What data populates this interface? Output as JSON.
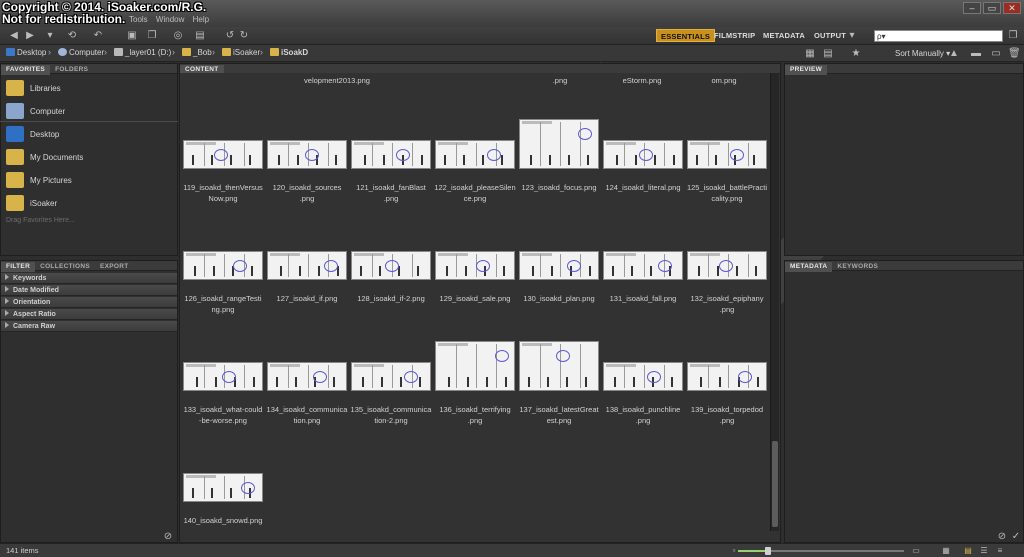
{
  "watermark": {
    "line1": "Copyright © 2014. iSoaker.com/R.G.",
    "line2": "Not for redistribution."
  },
  "menu": {
    "items": [
      "Tools",
      "Window",
      "Help"
    ]
  },
  "workspaces": {
    "essentials": "ESSENTIALS",
    "filmstrip": "FILMSTRIP",
    "metadata": "METADATA",
    "output": "OUTPUT"
  },
  "search": {
    "placeholder": "ρ▾"
  },
  "sort": {
    "label": "Sort Manually"
  },
  "breadcrumb": [
    {
      "label": "Desktop"
    },
    {
      "label": "Computer"
    },
    {
      "label": "_layer01 (D:)"
    },
    {
      "label": "_Bob"
    },
    {
      "label": "iSoaker"
    },
    {
      "label": "iSoakD"
    }
  ],
  "panels": {
    "left_top_tabs": [
      "FAVORITES",
      "FOLDERS"
    ],
    "left_bottom_tabs": [
      "FILTER",
      "COLLECTIONS",
      "EXPORT"
    ],
    "content_tab": "CONTENT",
    "preview_tab": "PREVIEW",
    "right_bottom_tabs": [
      "METADATA",
      "KEYWORDS"
    ]
  },
  "favorites": [
    {
      "label": "Libraries",
      "icon": "libraries-icon",
      "color": "#d8b34a"
    },
    {
      "label": "Computer",
      "icon": "computer-icon",
      "color": "#8aa6cc"
    },
    {
      "label": "Desktop",
      "icon": "desktop-icon",
      "color": "#2f6fc4"
    },
    {
      "label": "My Documents",
      "icon": "folder-icon",
      "color": "#d8b34a"
    },
    {
      "label": "My Pictures",
      "icon": "folder-icon",
      "color": "#d8b34a"
    },
    {
      "label": "iSoaker",
      "icon": "folder-icon",
      "color": "#d8b34a"
    }
  ],
  "favorites_hint": "Drag Favorites Here...",
  "filters": [
    "Keywords",
    "Date Modified",
    "Orientation",
    "Aspect Ratio",
    "Camera Raw"
  ],
  "top_partial_labels": [
    "velopment2013.png",
    ".png",
    "eStorm.png",
    "om.png"
  ],
  "thumbnails": [
    {
      "name": "119_isoakd_thenVersusNow.png",
      "line1": "119_isoakd_thenVersus",
      "line2": "Now.png"
    },
    {
      "name": "120_isoakd_sources.png",
      "line1": "120_isoakd_sources",
      "line2": ".png"
    },
    {
      "name": "121_isoakd_fanBlast.png",
      "line1": "121_isoakd_fanBlast",
      "line2": ".png"
    },
    {
      "name": "122_isoakd_pleaseSilence.png",
      "line1": "122_isoakd_pleaseSilen",
      "line2": "ce.png"
    },
    {
      "name": "123_isoakd_focus.png",
      "line1": "123_isoakd_focus.png",
      "line2": ""
    },
    {
      "name": "124_isoakd_literal.png",
      "line1": "124_isoakd_literal.png",
      "line2": ""
    },
    {
      "name": "125_isoakd_battlePracticality.png",
      "line1": "125_isoakd_battlePracti",
      "line2": "cality.png"
    },
    {
      "name": "126_isoakd_rangeTesting.png",
      "line1": "126_isoakd_rangeTesti",
      "line2": "ng.png"
    },
    {
      "name": "127_isoakd_if.png",
      "line1": "127_isoakd_if.png",
      "line2": ""
    },
    {
      "name": "128_isoakd_if-2.png",
      "line1": "128_isoakd_if-2.png",
      "line2": ""
    },
    {
      "name": "129_isoakd_sale.png",
      "line1": "129_isoakd_sale.png",
      "line2": ""
    },
    {
      "name": "130_isoakd_plan.png",
      "line1": "130_isoakd_plan.png",
      "line2": ""
    },
    {
      "name": "131_isoakd_fall.png",
      "line1": "131_isoakd_fall.png",
      "line2": ""
    },
    {
      "name": "132_isoakd_epiphany.png",
      "line1": "132_isoakd_epiphany",
      "line2": ".png"
    },
    {
      "name": "133_isoakd_what-could-be-worse.png",
      "line1": "133_isoakd_what-could",
      "line2": "-be-worse.png"
    },
    {
      "name": "134_isoakd_communication.png",
      "line1": "134_isoakd_communica",
      "line2": "tion.png"
    },
    {
      "name": "135_isoakd_communication-2.png",
      "line1": "135_isoakd_communica",
      "line2": "tion-2.png"
    },
    {
      "name": "136_isoakd_terrifying.png",
      "line1": "136_isoakd_terrifying",
      "line2": ".png"
    },
    {
      "name": "137_isoakd_latestGreatest.png",
      "line1": "137_isoakd_latestGreat",
      "line2": "est.png"
    },
    {
      "name": "138_isoakd_punchline.png",
      "line1": "138_isoakd_punchline",
      "line2": ".png"
    },
    {
      "name": "139_isoakd_torpedod.png",
      "line1": "139_isoakd_torpedod",
      "line2": ".png"
    },
    {
      "name": "140_isoakd_snowd.png",
      "line1": "140_isoakd_snowd.png",
      "line2": ""
    }
  ],
  "status": {
    "items_count": "141 items"
  },
  "colors": {
    "accent": "#c8901c",
    "panel": "#2f2f2f",
    "scribble": "#5a5ad8"
  }
}
